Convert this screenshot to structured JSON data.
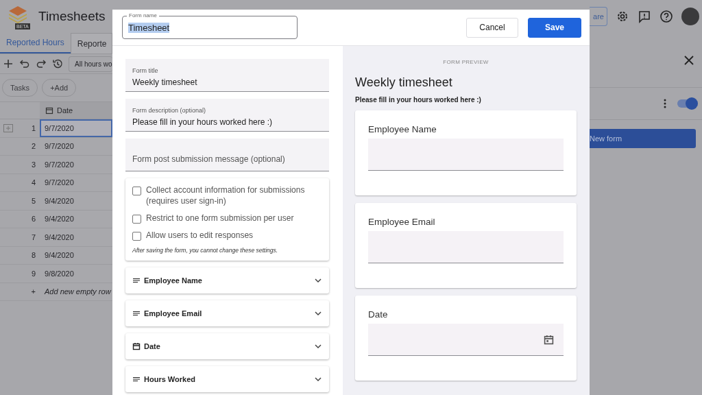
{
  "app": {
    "title": "Timesheets",
    "logo_badge": "BETA"
  },
  "tabs": [
    {
      "label": "Reported Hours",
      "selected": true
    },
    {
      "label": "Reporte",
      "selected": false
    }
  ],
  "toolbar": {
    "view_select": "All hours wo"
  },
  "chips": [
    "Tasks",
    "+Add"
  ],
  "table": {
    "columns": [
      "Date"
    ],
    "rows": [
      {
        "number": "1",
        "date": "9/7/2020",
        "selected": true
      },
      {
        "number": "2",
        "date": "9/7/2020",
        "selected": false
      },
      {
        "number": "3",
        "date": "9/7/2020",
        "selected": false
      },
      {
        "number": "4",
        "date": "9/7/2020",
        "selected": false
      },
      {
        "number": "5",
        "date": "9/4/2020",
        "selected": false
      },
      {
        "number": "6",
        "date": "9/4/2020",
        "selected": false
      },
      {
        "number": "7",
        "date": "9/4/2020",
        "selected": false
      },
      {
        "number": "8",
        "date": "9/4/2020",
        "selected": false
      },
      {
        "number": "9",
        "date": "9/8/2020",
        "selected": false
      }
    ],
    "add_row": {
      "icon": "+",
      "label": "Add new empty row"
    }
  },
  "header_actions": {
    "share": "are"
  },
  "side_panel": {
    "toggle_on": true,
    "new_form_button": "New form"
  },
  "dialog": {
    "form_name": {
      "label": "Form name",
      "value": "Timesheet",
      "text_selected": true
    },
    "buttons": [
      {
        "label": "Cancel",
        "kind": "secondary"
      },
      {
        "label": "Save",
        "kind": "primary"
      }
    ],
    "fields": [
      {
        "label": "Form title",
        "value": "Weekly timesheet"
      },
      {
        "label": "Form description (optional)",
        "value": "Please fill in your hours worked here :)"
      },
      {
        "placeholder": "Form post submission message (optional)"
      }
    ],
    "settings": {
      "options": [
        {
          "label": "Collect account information for submissions (requires user sign-in)",
          "checked": false
        },
        {
          "label": "Restrict to one form submission per user",
          "checked": false
        },
        {
          "label": "Allow users to edit responses",
          "checked": false
        }
      ],
      "note": "After saving the form, you cannot change these settings."
    },
    "questions": [
      {
        "label": "Employee Name",
        "kind": "text"
      },
      {
        "label": "Employee Email",
        "kind": "text"
      },
      {
        "label": "Date",
        "kind": "date"
      },
      {
        "label": "Hours Worked",
        "kind": "text"
      }
    ]
  },
  "preview": {
    "heading": "FORM PREVIEW",
    "title": "Weekly timesheet",
    "description": "Please fill in your hours worked here :)",
    "questions": [
      {
        "label": "Employee Name",
        "kind": "text"
      },
      {
        "label": "Employee Email",
        "kind": "text"
      },
      {
        "label": "Date",
        "kind": "date"
      }
    ]
  }
}
